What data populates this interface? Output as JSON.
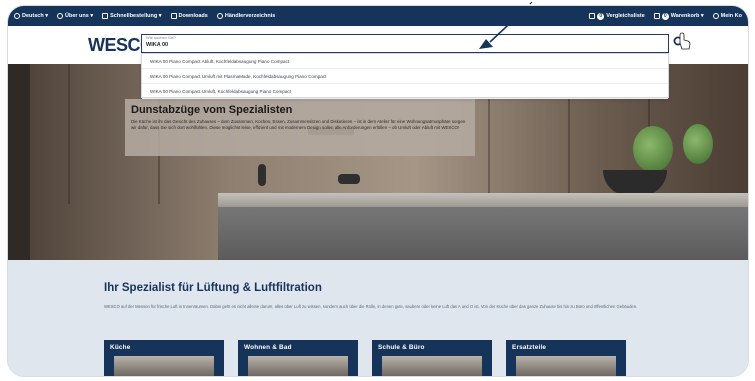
{
  "colors": {
    "navy": "#16335a",
    "section_bg": "#dfe6ee",
    "white": "#ffffff"
  },
  "topbar": {
    "left": [
      {
        "label": "Deutsch ▾",
        "icon": "globe-icon"
      },
      {
        "label": "Über uns ▾",
        "icon": "info-icon"
      },
      {
        "label": "Schnellbestellung ▾",
        "icon": "lightning-icon"
      },
      {
        "label": "Downloads",
        "icon": "download-icon"
      },
      {
        "label": "Händlerverzeichnis",
        "icon": "location-icon"
      }
    ],
    "right": [
      {
        "label": "Vergleichsliste",
        "badge": "0",
        "icon": "compare-icon"
      },
      {
        "label": "Warenkorb ▾",
        "badge": "0",
        "icon": "cart-icon"
      },
      {
        "label": "Mein Ko",
        "icon": "user-icon"
      }
    ]
  },
  "header": {
    "logo": "WESCO",
    "search": {
      "label": "Wie suchen Sie?",
      "value": "WIKA 00"
    },
    "suggestions": [
      "WIKA 00 Piano Compact Abluft, Kochfeldabsaugung Piano Compact",
      "WIKA 00 Piano Compact Umluft mit PlasmaMade, Kochfeldabsaugung Piano Compact",
      "WIKA 00 Piano Compact Umluft, Kochfeldabsaugung Piano Compact"
    ]
  },
  "hero": {
    "title": "Dunstabzüge vom Spezialisten",
    "text": "Die Küche ist ihr das Gesicht des Zuhauses – dem Zusammen, Kochen, Essen, Zusammensitzen und Diskutieren – ist in dem Atelier für eine Wohnungsatmosphäre sorgen wir dafür, dass Sie sich dort wohlfühlen. Diese möglichst leise, effizient und mit modernem Design sollen alle Anforderungen erfüllen – ob Umluft oder Abluft mit WESCO!"
  },
  "section": {
    "title": "Ihr Spezialist für Lüftung & Luftfiltration",
    "text": "WESCO auf der Messen für frische Luft in Innenräumen. Dabei geht es nicht alleine darum, alles über Luft zu wissen, sondern auch über die Rolle, in denen gute, saubere oder keine Luft das A und O ist. Von der Küche über das ganze Zuhause bis hin zu Büro und öffentlichen Gebäuden."
  },
  "categories": [
    "Küche",
    "Wohnen & Bad",
    "Schule & Büro",
    "Ersatzteile"
  ]
}
